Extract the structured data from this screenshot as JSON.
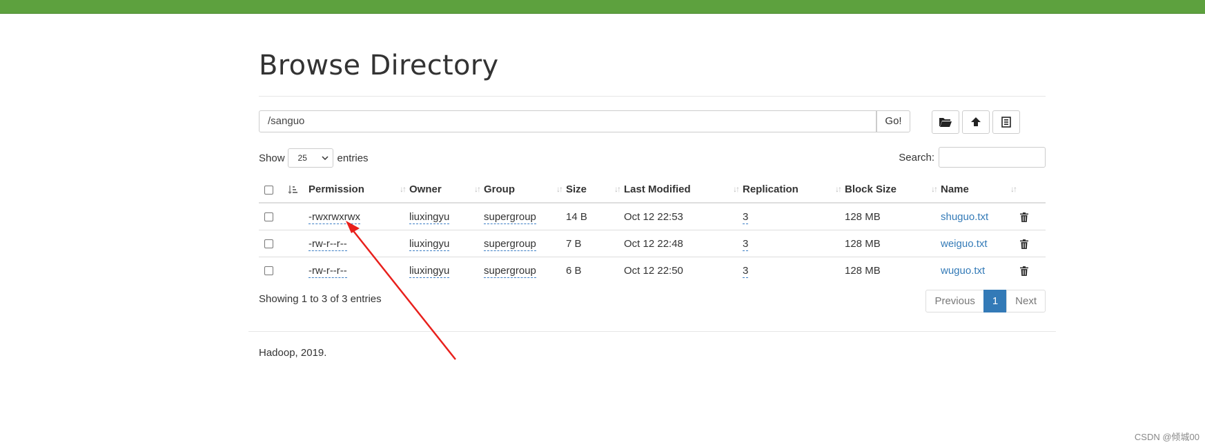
{
  "page": {
    "title": "Browse Directory",
    "footer": "Hadoop, 2019.",
    "watermark": "CSDN @倾城00"
  },
  "toolbar": {
    "path_value": "/sanguo",
    "go_label": "Go!",
    "icons": [
      "folder-open-icon",
      "cloud-upload-icon",
      "list-icon"
    ]
  },
  "entries": {
    "show_label": "Show",
    "page_size": "25",
    "entries_label": "entries",
    "search_label": "Search:",
    "search_value": ""
  },
  "table": {
    "columns": [
      "Permission",
      "Owner",
      "Group",
      "Size",
      "Last Modified",
      "Replication",
      "Block Size",
      "Name"
    ],
    "rows": [
      {
        "permission": "-rwxrwxrwx",
        "owner": "liuxingyu",
        "group": "supergroup",
        "size": "14 B",
        "modified": "Oct 12 22:53",
        "replication": "3",
        "block_size": "128 MB",
        "name": "shuguo.txt"
      },
      {
        "permission": "-rw-r--r--",
        "owner": "liuxingyu",
        "group": "supergroup",
        "size": "7 B",
        "modified": "Oct 12 22:48",
        "replication": "3",
        "block_size": "128 MB",
        "name": "weiguo.txt"
      },
      {
        "permission": "-rw-r--r--",
        "owner": "liuxingyu",
        "group": "supergroup",
        "size": "6 B",
        "modified": "Oct 12 22:50",
        "replication": "3",
        "block_size": "128 MB",
        "name": "wuguo.txt"
      }
    ]
  },
  "pagination": {
    "info": "Showing 1 to 3 of 3 entries",
    "previous": "Previous",
    "current": "1",
    "next": "Next"
  },
  "colors": {
    "topbar": "#5da13e",
    "link": "#337ab7",
    "annotation_arrow": "#e8201c"
  }
}
